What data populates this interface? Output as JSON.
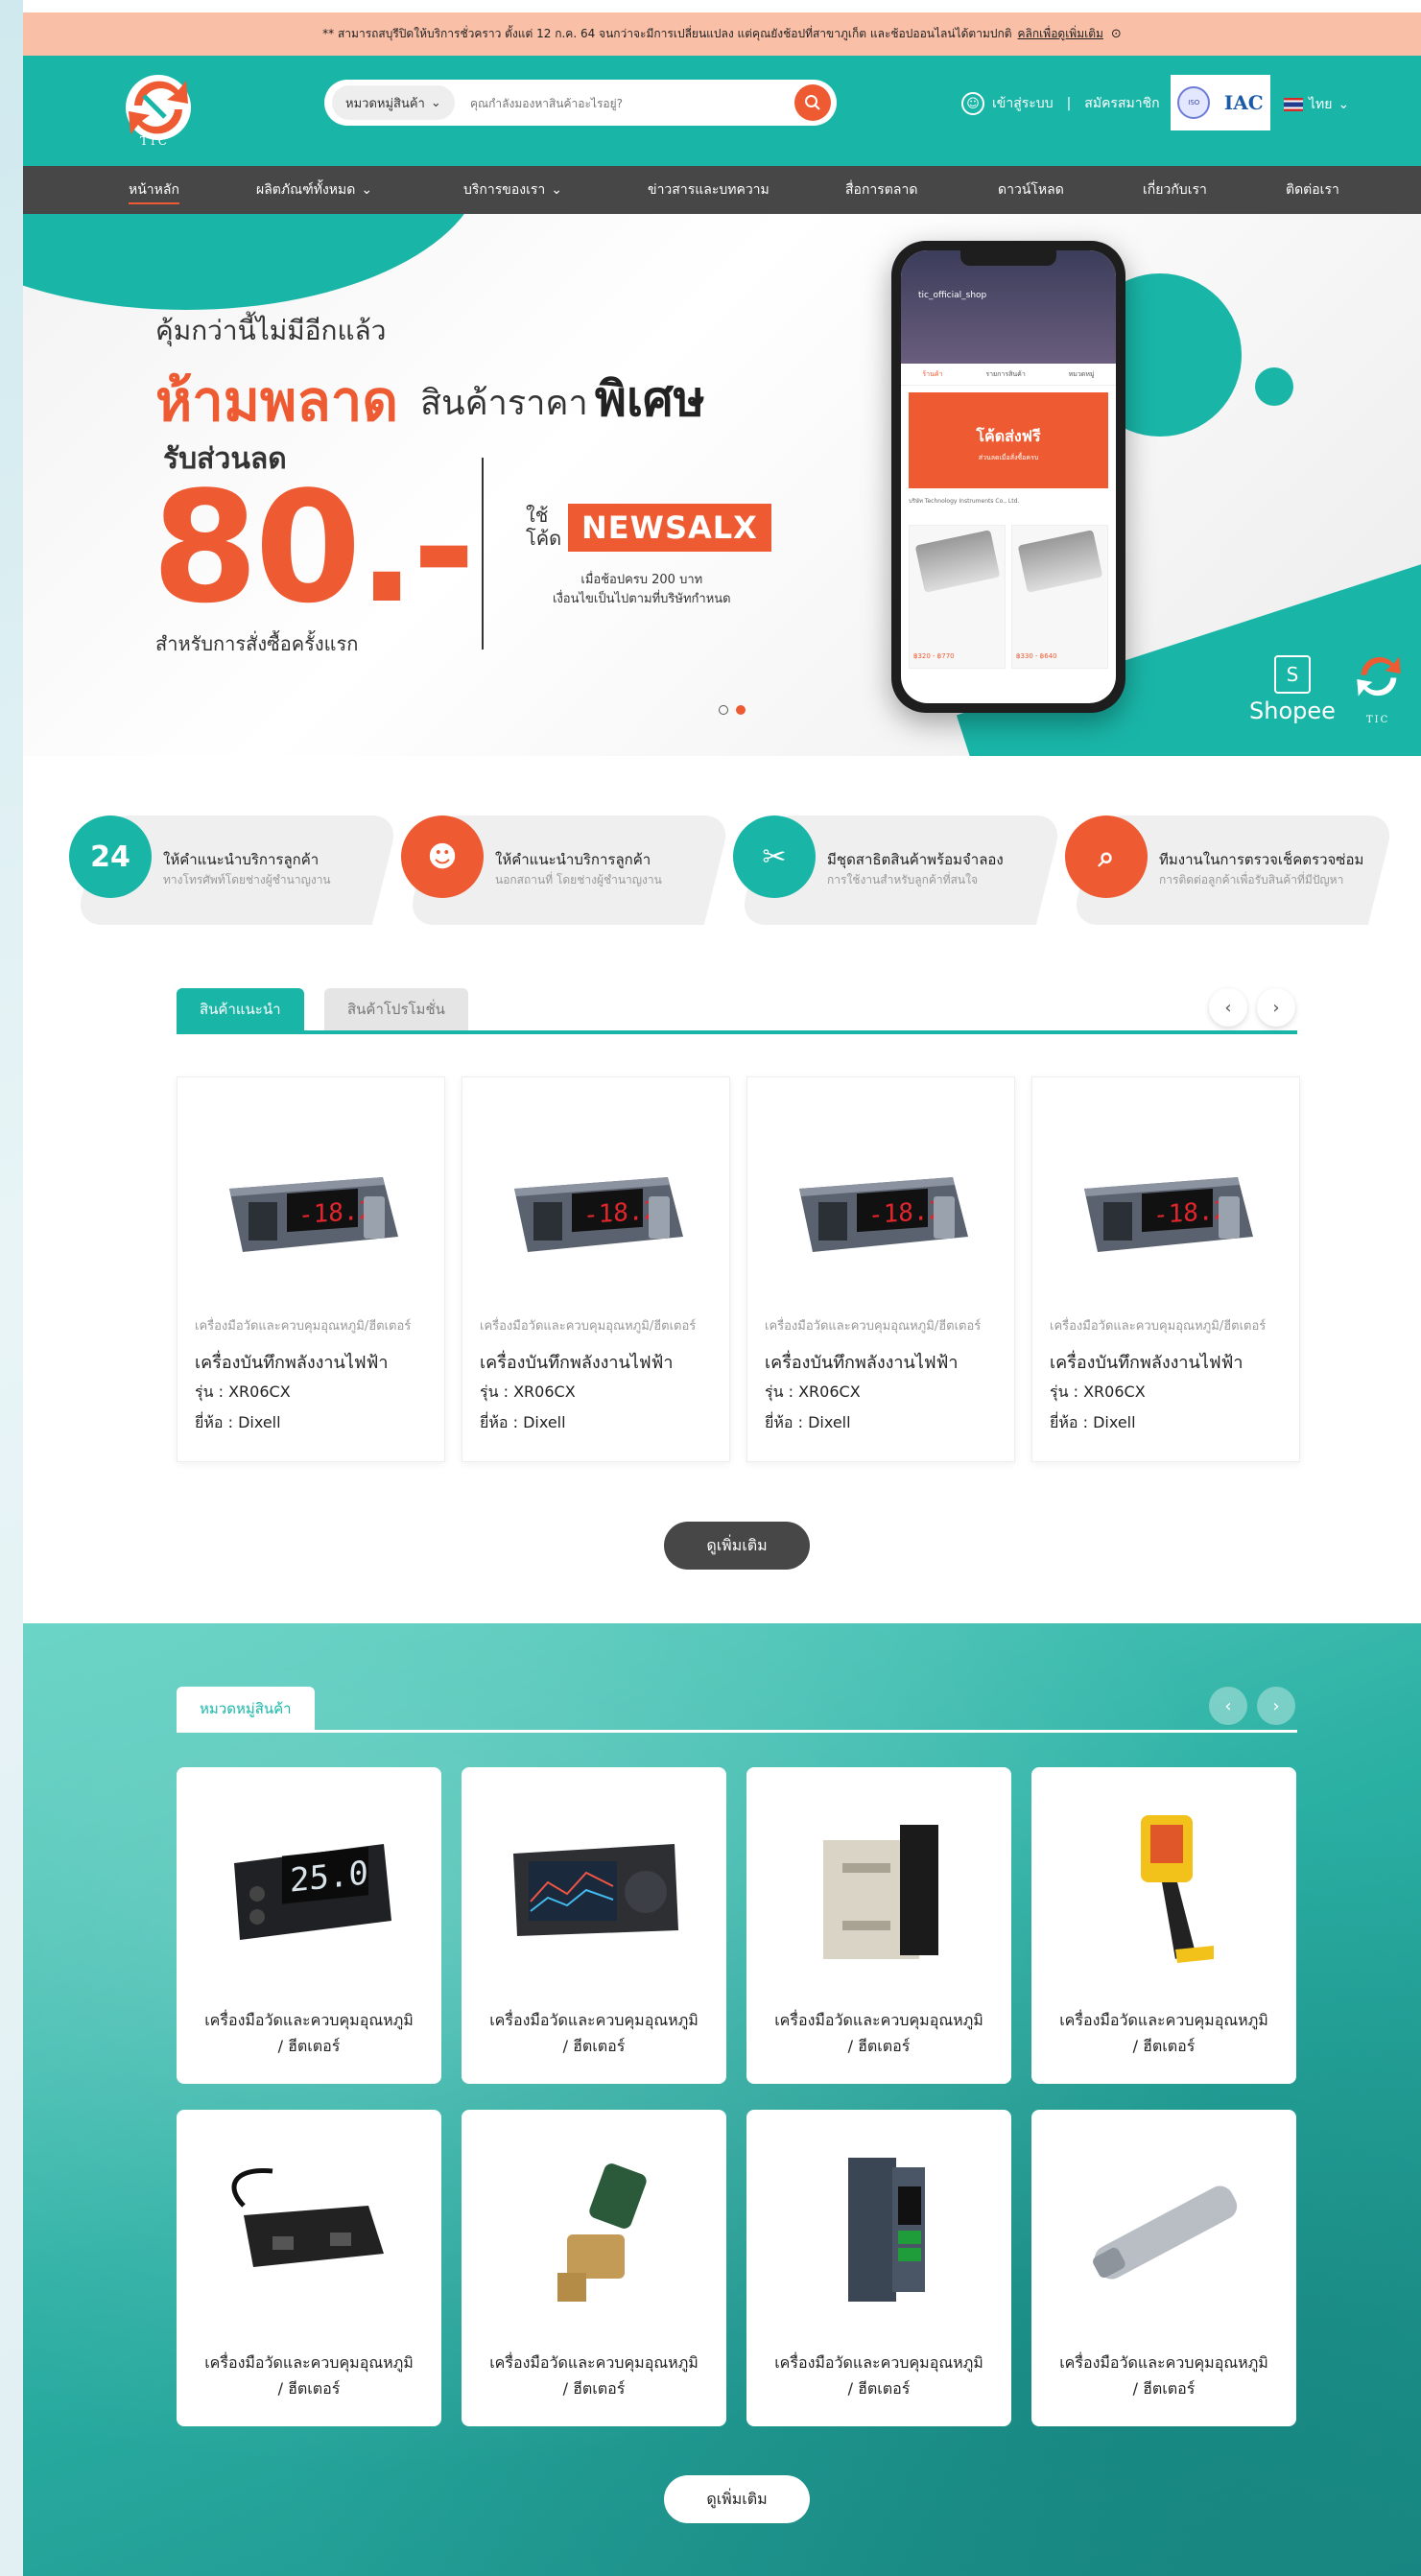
{
  "notice": {
    "text": "** สามารถสบุรีปิดให้บริการชั่วคราว ตั้งแต่ 12 ก.ค. 64 จนกว่าจะมีการเปลี่ยนแปลง แต่คุณยังช้อปที่สาขาภูเก็ต และช้อปออนไลน่ได้ตามปกติ",
    "link": "คลิกเพื่อดูเพิ่มเติม",
    "icon": "clock-icon"
  },
  "header": {
    "logo_text": "TIC",
    "search": {
      "category_label": "หมวดหมู่สินค้า",
      "placeholder": "คุณกำลังมองหาสินค้าอะไรอยู่?"
    },
    "login": "เข้าสู่ระบบ",
    "separator": "|",
    "register": "สมัครสมาชิก",
    "language": "ไทย",
    "accent_color": "#19b6a8"
  },
  "nav": {
    "items": [
      "หน้าหลัก",
      "ผลิตภัณฑ์ทั้งหมด",
      "บริการของเรา",
      "ข่าวสารและบทความ",
      "สื่อการตลาด",
      "ดาวน์โหลด",
      "เกี่ยวกับเรา",
      "ติดต่อเรา"
    ],
    "dropdown_suffix": "⌄"
  },
  "hero": {
    "line1": "คุ้มกว่านี้ไม่มีอีกแล้ว",
    "line2a": "ห้ามพลาด",
    "line2b": "สินค้าราคา",
    "line2c": "พิเศษ",
    "line3": "รับส่วนลด",
    "amount": "80.-",
    "first_order": "สำหรับการสั่งซื้อครั้งแรก",
    "use": "ใช้",
    "code_label": "โค้ด",
    "code": "NEWSALX",
    "condition1": "เมื่อช้อปครบ 200 บาท",
    "condition2": "เงื่อนไขเป็นไปตามที่บริษัทกำหนด",
    "phone": {
      "shop_name": "tic_official_shop",
      "tabs": [
        "ร้านค้า",
        "รายการสินค้า",
        "หมวดหมู่"
      ],
      "promo_title": "โค้ดส่งฟรี",
      "promo_sub": "ส่วนลดเมื่อสั่งซื้อครบ",
      "info": "บริษัท Technology Instruments Co., Ltd.",
      "prices": [
        "฿320 - ฿770",
        "฿330 - ฿640"
      ]
    },
    "shopee": "Shopee"
  },
  "features": [
    {
      "title": "ให้คำแนะนำบริการลูกค้า",
      "sub": "ทางโทรศัพท์โดยช่างผู้ชำนาญงาน",
      "icon": "support-24-icon",
      "color": "#19b6a8"
    },
    {
      "title": "ให้คำแนะนำบริการลูกค้า",
      "sub": "นอกสถานที่ โดยช่างผู้ชำนาญงาน",
      "icon": "engineer-icon",
      "color": "#ee5b32"
    },
    {
      "title": "มีชุดสาธิตสินค้าพร้อมจำลอง",
      "sub": "การใช้งานสำหรับลูกค้าที่สนใจ",
      "icon": "tools-icon",
      "color": "#19b6a8"
    },
    {
      "title": "ทีมงานในการตรวจเช็คตรวจซ่อม",
      "sub": "การติดต่อลูกค้าเพื่อรับสินค้าที่มีปัญหา",
      "icon": "inspect-icon",
      "color": "#ee5b32"
    }
  ],
  "products_section": {
    "tab_recommended": "สินค้าแนะนำ",
    "tab_promotion": "สินค้าโปรโมชั่น",
    "products": [
      {
        "category": "เครื่องมือวัดและควบคุมอุณหภูมิ/ฮีตเตอร์",
        "name": "เครื่องบันทึกพลังงานไฟฟ้า",
        "model": "รุ่น : XR06CX",
        "brand": "ยี่ห้อ : Dixell",
        "display": "-18.2"
      },
      {
        "category": "เครื่องมือวัดและควบคุมอุณหภูมิ/ฮีตเตอร์",
        "name": "เครื่องบันทึกพลังงานไฟฟ้า",
        "model": "รุ่น : XR06CX",
        "brand": "ยี่ห้อ : Dixell",
        "display": "-18.2"
      },
      {
        "category": "เครื่องมือวัดและควบคุมอุณหภูมิ/ฮีตเตอร์",
        "name": "เครื่องบันทึกพลังงานไฟฟ้า",
        "model": "รุ่น : XR06CX",
        "brand": "ยี่ห้อ : Dixell",
        "display": "-18.2"
      },
      {
        "category": "เครื่องมือวัดและควบคุมอุณหภูมิ/ฮีตเตอร์",
        "name": "เครื่องบันทึกพลังงานไฟฟ้า",
        "model": "รุ่น : XR06CX",
        "brand": "ยี่ห้อ : Dixell",
        "display": "-18.2"
      }
    ],
    "more": "ดูเพิ่มเติม"
  },
  "categories_section": {
    "tab": "หมวดหมู่สินค้า",
    "items": [
      {
        "line1": "เครื่องมือวัดและควบคุมอุณหภูมิ",
        "line2": "/ ฮีตเตอร์",
        "image": "panel-thermometer"
      },
      {
        "line1": "เครื่องมือวัดและควบคุมอุณหภูมิ",
        "line2": "/ ฮีตเตอร์",
        "image": "data-recorder"
      },
      {
        "line1": "เครื่องมือวัดและควบคุมอุณหภูมิ",
        "line2": "/ ฮีตเตอร์",
        "image": "solid-state-relay"
      },
      {
        "line1": "เครื่องมือวัดและควบคุมอุณหภูมิ",
        "line2": "/ ฮีตเตอร์",
        "image": "thermal-camera"
      },
      {
        "line1": "เครื่องมือวัดและควบคุมอุณหภูมิ",
        "line2": "/ ฮีตเตอร์",
        "image": "sensor-box"
      },
      {
        "line1": "เครื่องมือวัดและควบคุมอุณหภูมิ",
        "line2": "/ ฮีตเตอร์",
        "image": "solenoid-valve"
      },
      {
        "line1": "เครื่องมือวัดและควบคุมอุณหภูมิ",
        "line2": "/ ฮีตเตอร์",
        "image": "din-rail-meter"
      },
      {
        "line1": "เครื่องมือวัดและควบคุมอุณหภูมิ",
        "line2": "/ ฮีตเตอร์",
        "image": "proximity-sensor"
      }
    ],
    "more": "ดูเพิ่มเติม"
  },
  "cat_display": "25.0"
}
